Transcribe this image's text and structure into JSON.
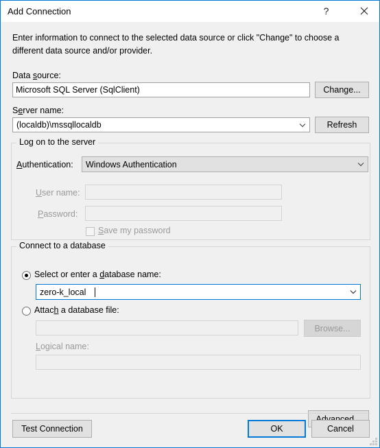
{
  "window": {
    "title": "Add Connection",
    "help_icon": "question-mark-icon",
    "close_icon": "close-icon"
  },
  "intro": {
    "text": "Enter information to connect to the selected data source or click \"Change\" to choose a different data source and/or provider."
  },
  "data_source": {
    "label": "Data source:",
    "value": "Microsoft SQL Server (SqlClient)",
    "change_button": "Change..."
  },
  "server": {
    "label": "Server name:",
    "value": "(localdb)\\mssqllocaldb",
    "refresh_button": "Refresh"
  },
  "logon_group": {
    "title": "Log on to the server",
    "authentication_label": "Authentication:",
    "authentication_value": "Windows Authentication",
    "username_label": "User name:",
    "username_value": "",
    "password_label": "Password:",
    "password_value": "",
    "save_password_label": "Save my password",
    "save_password_checked": false
  },
  "database_group": {
    "title": "Connect to a database",
    "select_radio_label": "Select or enter a database name:",
    "select_radio_checked": true,
    "database_value": "zero-k_local",
    "attach_radio_label": "Attach a database file:",
    "attach_radio_checked": false,
    "attach_file_value": "",
    "browse_button": "Browse...",
    "logical_name_label": "Logical name:",
    "logical_name_value": ""
  },
  "footer": {
    "advanced_button": "Advanced...",
    "test_connection_button": "Test Connection",
    "ok_button": "OK",
    "cancel_button": "Cancel"
  },
  "colors": {
    "accent": "#0078d7",
    "dialog_bg": "#f0f0f0",
    "button_bg": "#e1e1e1",
    "disabled_text": "#9a9a9a"
  }
}
